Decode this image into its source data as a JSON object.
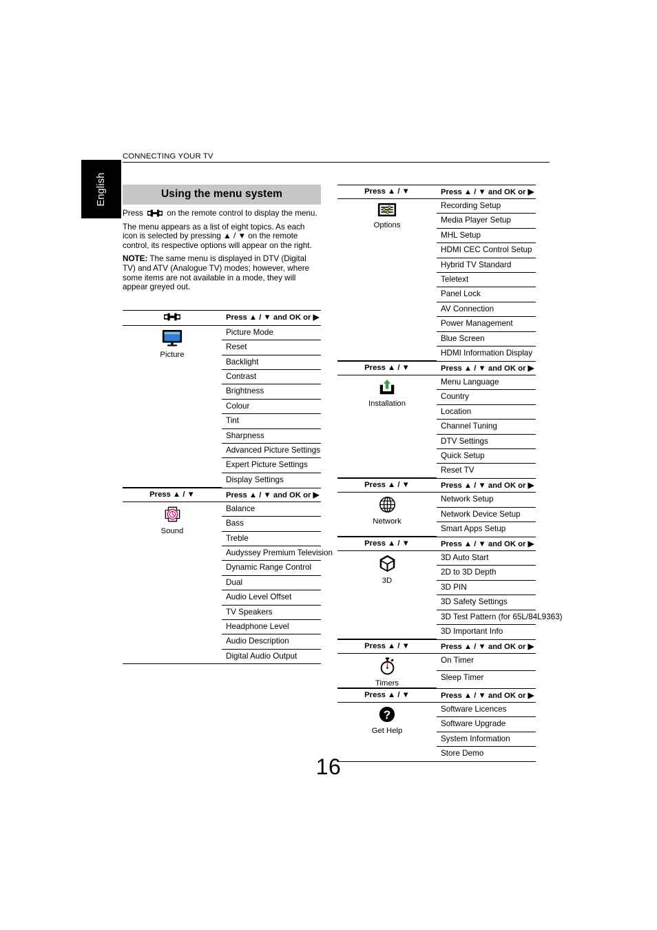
{
  "page": {
    "running_head": "CONNECTING YOUR TV",
    "language_tab": "English",
    "page_number": "16"
  },
  "intro": {
    "banner_title": "Using the menu system",
    "para1_before": "Press",
    "para1_after": "on the remote control to display the menu.",
    "para2": "The menu appears as a list of eight topics. As each icon is selected by pressing ▲ / ▼ on the remote control, its respective options will appear on the right.",
    "note_label": "NOTE:",
    "note_text": " The same menu is displayed in DTV (Digital TV) and ATV (Analogue TV) modes; however, where some items are not available in a mode, they will appear greyed out."
  },
  "headers": {
    "press_updown": "Press ▲ / ▼",
    "press_updown_ok": "Press ▲ / ▼ and OK or ▶"
  },
  "left_tables": [
    {
      "icon": "wrench-icon",
      "header_left": "",
      "header_left_icon": "wrench-icon",
      "menu_icon": "picture-monitor-icon",
      "menu_label": "Picture",
      "options": [
        "Picture Mode",
        "Reset",
        "Backlight",
        "Contrast",
        "Brightness",
        "Colour",
        "Tint",
        "Sharpness",
        "Advanced Picture Settings",
        "Expert Picture Settings",
        "Display Settings"
      ]
    },
    {
      "menu_icon": "sound-icon",
      "menu_label": "Sound",
      "options": [
        "Balance",
        "Bass",
        "Treble",
        "Audyssey Premium Television",
        "Dynamic Range Control",
        "Dual",
        "Audio Level Offset",
        "TV Speakers",
        "Headphone Level",
        "Audio Description",
        "Digital Audio Output"
      ]
    }
  ],
  "right_tables": [
    {
      "menu_icon": "options-sliders-icon",
      "menu_label": "Options",
      "options": [
        "Recording Setup",
        "Media Player Setup",
        "MHL Setup",
        "HDMI CEC Control Setup",
        "Hybrid TV Standard",
        "Teletext",
        "Panel Lock",
        "AV Connection",
        "Power Management",
        "Blue Screen",
        "HDMI Information Display"
      ]
    },
    {
      "menu_icon": "installation-icon",
      "menu_label": "Installation",
      "options": [
        "Menu Language",
        "Country",
        "Location",
        "Channel Tuning",
        "DTV Settings",
        "Quick Setup",
        "Reset TV"
      ]
    },
    {
      "menu_icon": "network-globe-icon",
      "menu_label": "Network",
      "options": [
        "Network Setup",
        "Network Device Setup",
        "Smart Apps Setup"
      ]
    },
    {
      "menu_icon": "cube-3d-icon",
      "menu_label": "3D",
      "options": [
        "3D Auto Start",
        "2D to 3D Depth",
        "3D PIN",
        "3D Safety Settings",
        "3D Test Pattern (for 65L/84L9363)",
        "3D Important Info"
      ]
    },
    {
      "menu_icon": "stopwatch-icon",
      "menu_label": "Timers",
      "options": [
        "On Timer",
        "Sleep Timer"
      ]
    },
    {
      "menu_icon": "question-mark-icon",
      "menu_label": "Get Help",
      "options": [
        "Software Licences",
        "Software Upgrade",
        "System Information",
        "Store Demo"
      ]
    }
  ],
  "colors": {
    "banner_grey": "#c6c6c6",
    "sound_magenta": "#c2257f",
    "installation_green": "#3f9b46",
    "picture_blue": "#2e7fd4",
    "timer_red": "#d42a22",
    "options_yellow": "#f2c21a"
  }
}
